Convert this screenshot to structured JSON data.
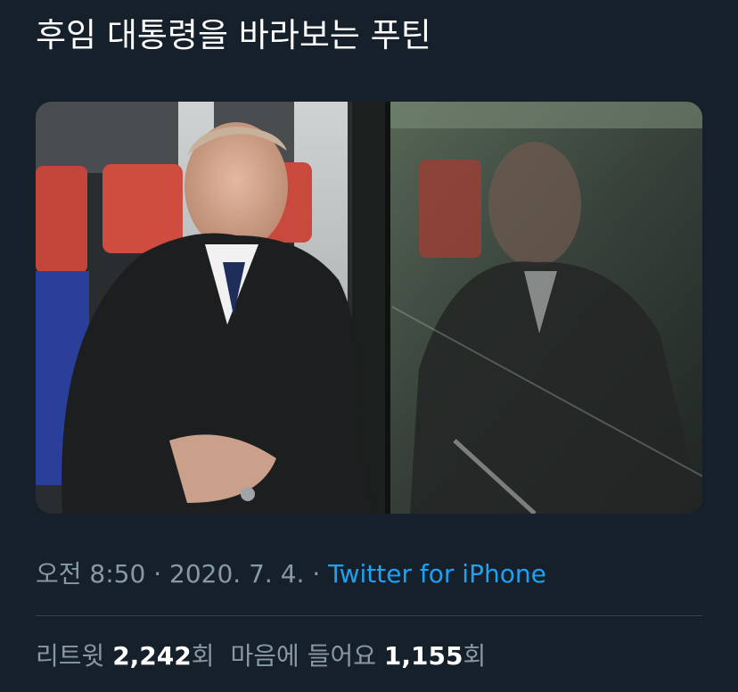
{
  "tweet": {
    "text": "후임 대통령을 바라보는 푸틴"
  },
  "meta": {
    "time": "오전 8:50",
    "separator": "·",
    "date": "2020. 7. 4.",
    "source": "Twitter for iPhone"
  },
  "stats": {
    "retweets_label": "리트윗",
    "retweets_count": "2,242",
    "retweets_unit": "회",
    "likes_label": "마음에 들어요",
    "likes_count": "1,155",
    "likes_unit": "회"
  },
  "colors": {
    "background": "#15202b",
    "link": "#1da1f2",
    "secondary_text": "#8899a6"
  }
}
